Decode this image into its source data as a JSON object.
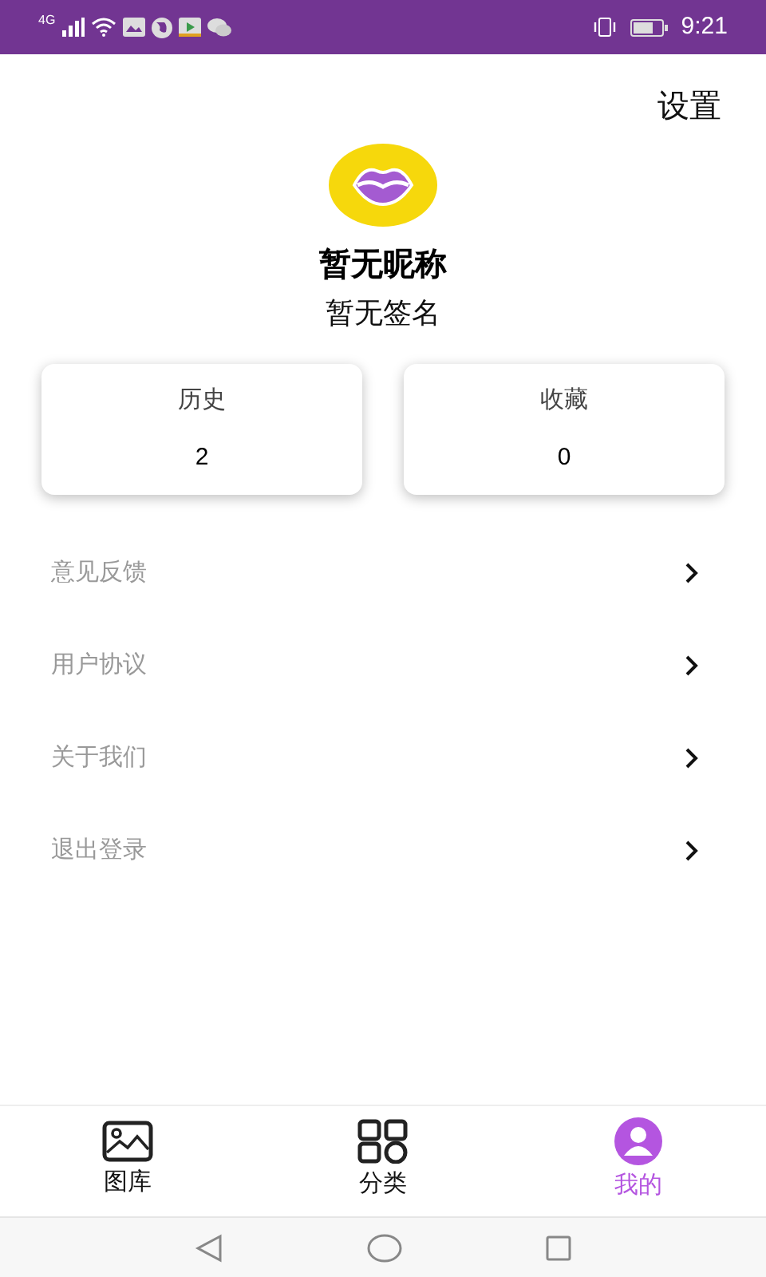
{
  "status_bar": {
    "network": "4G",
    "time": "9:21"
  },
  "header": {
    "settings": "设置"
  },
  "profile": {
    "nickname": "暂无昵称",
    "signature": "暂无签名"
  },
  "stats": [
    {
      "label": "历史",
      "value": "2"
    },
    {
      "label": "收藏",
      "value": "0"
    }
  ],
  "menu": [
    {
      "label": "意见反馈"
    },
    {
      "label": "用户协议"
    },
    {
      "label": "关于我们"
    },
    {
      "label": "退出登录"
    }
  ],
  "tabs": [
    {
      "label": "图库",
      "kind": "gallery",
      "selected": false
    },
    {
      "label": "分类",
      "kind": "category",
      "selected": false
    },
    {
      "label": "我的",
      "kind": "profile",
      "selected": true
    }
  ]
}
